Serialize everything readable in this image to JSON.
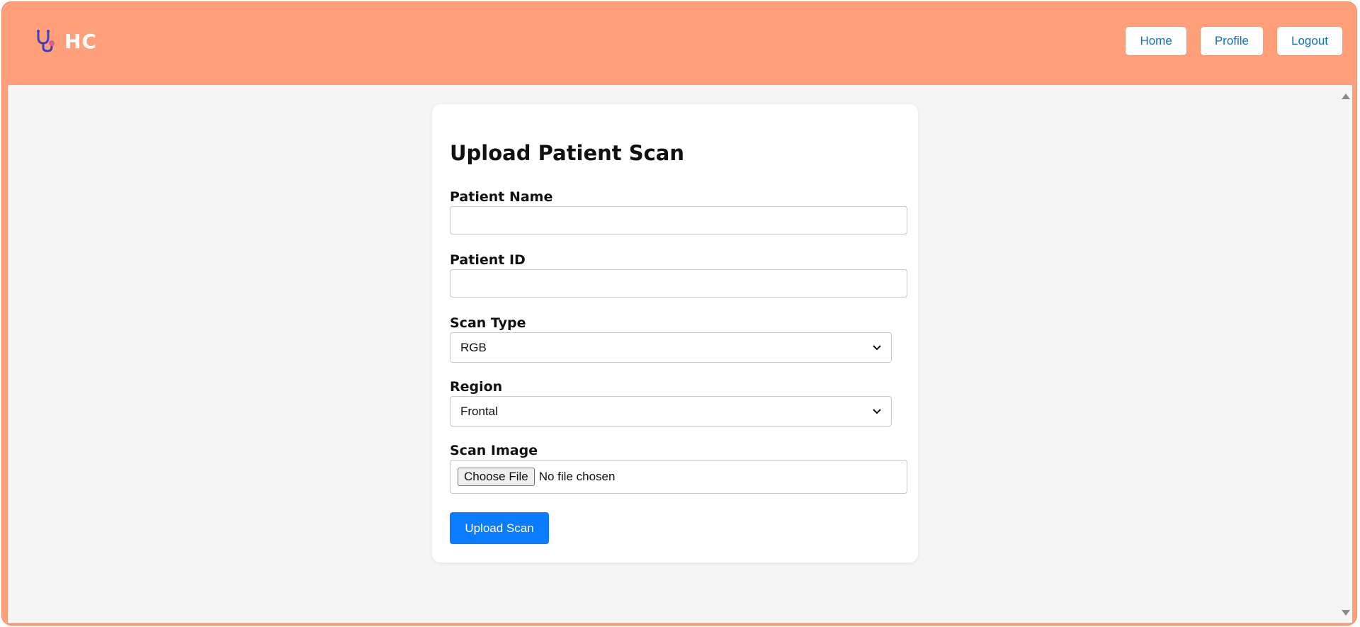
{
  "app": {
    "logo_text": "HC",
    "logo_icon": "stethoscope-icon"
  },
  "nav": {
    "home": "Home",
    "profile": "Profile",
    "logout": "Logout"
  },
  "form": {
    "title": "Upload Patient Scan",
    "patient_name": {
      "label": "Patient Name",
      "value": ""
    },
    "patient_id": {
      "label": "Patient ID",
      "value": ""
    },
    "scan_type": {
      "label": "Scan Type",
      "selected": "RGB"
    },
    "region": {
      "label": "Region",
      "selected": "Frontal"
    },
    "scan_image": {
      "label": "Scan Image",
      "button": "Choose File",
      "status": "No file chosen"
    },
    "submit": "Upload Scan"
  },
  "colors": {
    "header_bg": "#ffa07a",
    "page_bg": "#f5f5f5",
    "nav_text": "#0e6fc2",
    "primary_button": "#0a7cff",
    "logo_icon_blue": "#3f3fbf",
    "logo_icon_pink": "#e05a8a"
  }
}
